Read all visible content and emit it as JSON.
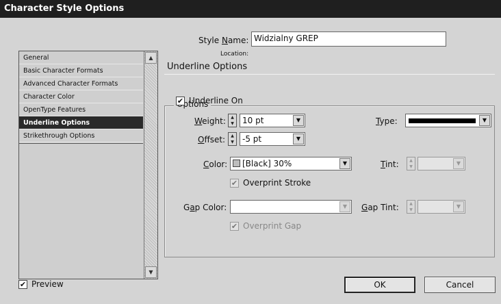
{
  "window": {
    "title": "Character Style Options"
  },
  "sidebar": {
    "items": [
      {
        "label": "General"
      },
      {
        "label": "Basic Character Formats"
      },
      {
        "label": "Advanced Character Formats"
      },
      {
        "label": "Character Color"
      },
      {
        "label": "OpenType Features"
      },
      {
        "label": "Underline Options"
      },
      {
        "label": "Strikethrough Options"
      }
    ],
    "selected_index": 5
  },
  "style_name": {
    "label_pre": "Style ",
    "label_key": "N",
    "label_post": "ame:",
    "value": "Widzialny GREP"
  },
  "location": {
    "label": "Location:"
  },
  "section": {
    "title": "Underline Options"
  },
  "options_group": {
    "title": "Options",
    "underline_on": {
      "label": "Underline On",
      "checked": true
    },
    "weight": {
      "label_key": "W",
      "label_post": "eight:",
      "value": "10 pt"
    },
    "offset": {
      "label_key": "O",
      "label_post": "ffset:",
      "value": "-5 pt"
    },
    "type": {
      "label_key": "T",
      "label_post": "ype:"
    },
    "color": {
      "label_key": "C",
      "label_post": "olor:",
      "value": "[Black] 30%"
    },
    "tint": {
      "label_key": "T",
      "label_post": "int:",
      "value": ""
    },
    "overprint_stroke": {
      "label": "Overprint Stroke",
      "checked": true
    },
    "gap_color": {
      "label_pre": "G",
      "label_key": "a",
      "label_post": "p Color:",
      "value": ""
    },
    "gap_tint": {
      "label_key": "G",
      "label_post": "ap Tint:",
      "value": ""
    },
    "overprint_gap": {
      "label": "Overprint Gap",
      "checked": true
    }
  },
  "preview": {
    "label": "Preview",
    "checked": true
  },
  "buttons": {
    "ok": "OK",
    "cancel": "Cancel"
  },
  "icons": {
    "check": "✔",
    "up_arrow": "▲",
    "down_arrow": "▼"
  }
}
